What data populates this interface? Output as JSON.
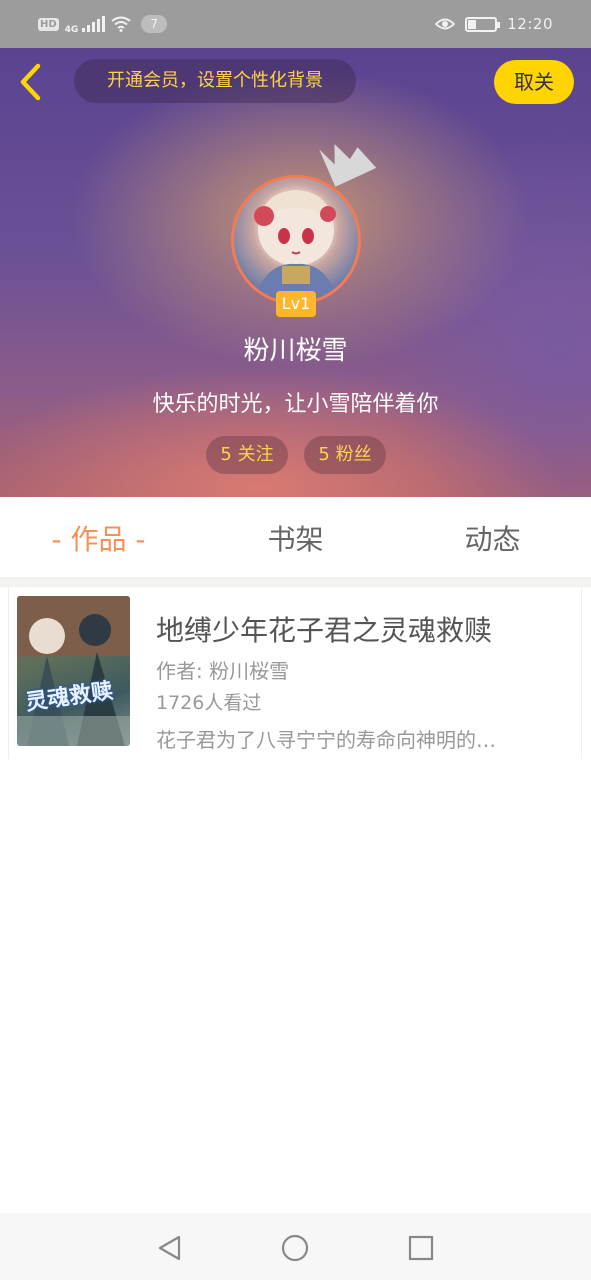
{
  "status_bar": {
    "hd": "HD",
    "network": "4G",
    "notification_count": "7",
    "time": "12:20"
  },
  "header": {
    "vip_banner": "开通会员，设置个性化背景",
    "follow_label": "取关",
    "level": "Lv1",
    "username": "粉川桜雪",
    "signature": "快乐的时光，让小雪陪伴着你",
    "following": "5 关注",
    "fans": "5 粉丝"
  },
  "tabs": [
    {
      "label": "- 作品 -",
      "active": true
    },
    {
      "label": "书架",
      "active": false
    },
    {
      "label": "动态",
      "active": false
    }
  ],
  "books": [
    {
      "title": "地缚少年花子君之灵魂救赎",
      "author": "作者: 粉川桜雪",
      "views": "1726人看过",
      "description": "花子君为了八寻宁宁的寿命向神明的…",
      "cover_text": "灵魂救赎"
    }
  ],
  "colors": {
    "accent_orange": "#f49058",
    "follow_yellow": "#ffd400",
    "chip_text": "#ffd24a",
    "level_badge": "#ffb52e"
  },
  "icons": {
    "back": "chevron-left-icon",
    "crown": "crown-icon",
    "nav_back": "triangle-back-icon",
    "nav_home": "circle-home-icon",
    "nav_recent": "square-recent-icon"
  }
}
